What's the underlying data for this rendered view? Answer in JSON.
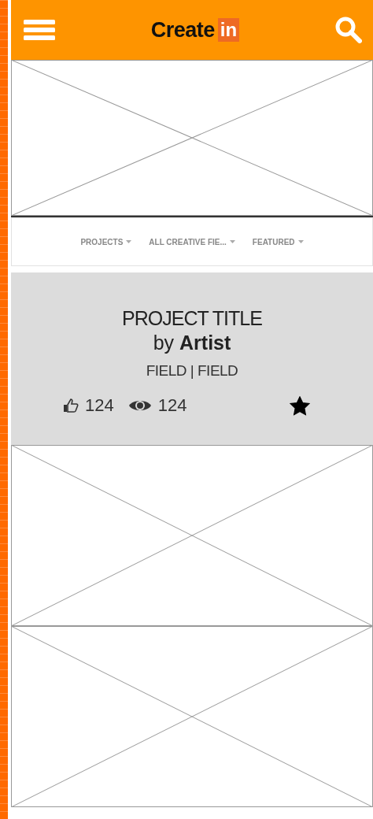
{
  "header": {
    "logo_text": "Create",
    "logo_badge": "in"
  },
  "feed": [
    {
      "kind": "placeholder"
    },
    {
      "kind": "filters",
      "items": [
        {
          "label": "PROJECTS"
        },
        {
          "label": "ALL CREATIVE FIE..."
        },
        {
          "label": "FEATURED"
        }
      ]
    },
    {
      "kind": "project",
      "title": "PROJECT TITLE",
      "byline": "by **Artist**",
      "fields": "FIELD | FIELD",
      "likes": "124",
      "views": "124",
      "starred": true
    },
    {
      "kind": "placeholder"
    },
    {
      "kind": "placeholder"
    }
  ]
}
